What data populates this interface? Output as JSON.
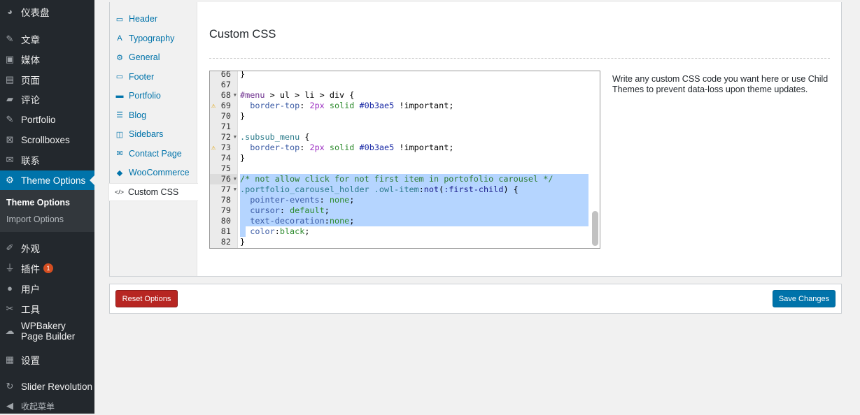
{
  "sidebar": {
    "items": [
      {
        "label": "仪表盘",
        "icon": "dashboard-icon"
      },
      {
        "label": "文章",
        "icon": "pin-icon"
      },
      {
        "label": "媒体",
        "icon": "media-icon"
      },
      {
        "label": "页面",
        "icon": "pages-icon"
      },
      {
        "label": "评论",
        "icon": "comments-icon"
      },
      {
        "label": "Portfolio",
        "icon": "pin-icon"
      },
      {
        "label": "Scrollboxes",
        "icon": "scrollbox-icon"
      },
      {
        "label": "联系",
        "icon": "mail-icon"
      },
      {
        "label": "Theme Options",
        "icon": "gear-icon"
      },
      {
        "label": "外观",
        "icon": "brush-icon"
      },
      {
        "label": "插件",
        "icon": "plugin-icon",
        "badge": "1"
      },
      {
        "label": "用户",
        "icon": "user-icon"
      },
      {
        "label": "工具",
        "icon": "wrench-icon"
      },
      {
        "label": "WPBakery Page Builder",
        "icon": "cloud-icon"
      },
      {
        "label": "设置",
        "icon": "settings-icon"
      },
      {
        "label": "Slider Revolution",
        "icon": "refresh-icon"
      },
      {
        "label": "收起菜单",
        "icon": "collapse-icon"
      }
    ],
    "submenu": [
      "Theme Options",
      "Import Options"
    ]
  },
  "tabs": [
    {
      "label": "Header",
      "icon": "monitor-icon"
    },
    {
      "label": "Typography",
      "icon": "typography-icon"
    },
    {
      "label": "General",
      "icon": "gear-icon"
    },
    {
      "label": "Footer",
      "icon": "monitor-icon"
    },
    {
      "label": "Portfolio",
      "icon": "briefcase-icon"
    },
    {
      "label": "Blog",
      "icon": "list-icon"
    },
    {
      "label": "Sidebars",
      "icon": "columns-icon"
    },
    {
      "label": "Contact Page",
      "icon": "envelope-icon"
    },
    {
      "label": "WooCommerce",
      "icon": "tag-icon"
    },
    {
      "label": "Custom CSS",
      "icon": "code-icon"
    }
  ],
  "section_title": "Custom CSS",
  "description": "Write any custom CSS code you want here or use Child Themes to prevent data-loss upon theme updates.",
  "editor": {
    "lines": [
      {
        "n": "66",
        "tokens": [
          {
            "t": "}"
          }
        ]
      },
      {
        "n": "67",
        "tokens": []
      },
      {
        "n": "68",
        "fold": true,
        "tokens": [
          {
            "t": "#menu",
            "c": "sel"
          },
          {
            "t": " > ul > li > div {"
          }
        ]
      },
      {
        "n": "69",
        "warn": true,
        "tokens": [
          {
            "t": "  "
          },
          {
            "t": "border-top",
            "c": "prop"
          },
          {
            "t": ": "
          },
          {
            "t": "2px",
            "c": "num"
          },
          {
            "t": " "
          },
          {
            "t": "solid",
            "c": "val"
          },
          {
            "t": " "
          },
          {
            "t": "#0b3ae5",
            "c": "hex"
          },
          {
            "t": " !important;"
          }
        ]
      },
      {
        "n": "70",
        "tokens": [
          {
            "t": "}"
          }
        ]
      },
      {
        "n": "71",
        "tokens": []
      },
      {
        "n": "72",
        "fold": true,
        "tokens": [
          {
            "t": ".subsub_menu",
            "c": "cls"
          },
          {
            "t": " {"
          }
        ]
      },
      {
        "n": "73",
        "warn": true,
        "tokens": [
          {
            "t": "  "
          },
          {
            "t": "border-top",
            "c": "prop"
          },
          {
            "t": ": "
          },
          {
            "t": "2px",
            "c": "num"
          },
          {
            "t": " "
          },
          {
            "t": "solid",
            "c": "val"
          },
          {
            "t": " "
          },
          {
            "t": "#0b3ae5",
            "c": "hex"
          },
          {
            "t": " !important;"
          }
        ]
      },
      {
        "n": "74",
        "tokens": [
          {
            "t": "}"
          }
        ]
      },
      {
        "n": "75",
        "tokens": []
      },
      {
        "n": "76",
        "fold": true,
        "sel": true,
        "cur": true,
        "tokens": [
          {
            "t": "/* not allow click for not first item in portofolio carousel */",
            "c": "com"
          }
        ]
      },
      {
        "n": "77",
        "fold": true,
        "sel": true,
        "tokens": [
          {
            "t": ".portfolio_carousel_holder .owl-item",
            "c": "cls"
          },
          {
            "t": ":"
          },
          {
            "t": "not",
            "c": "fn"
          },
          {
            "t": "("
          },
          {
            "t": ":first-child",
            "c": "fn"
          },
          {
            "t": ") {"
          }
        ]
      },
      {
        "n": "78",
        "sel": true,
        "tokens": [
          {
            "t": "  "
          },
          {
            "t": "pointer-events",
            "c": "prop"
          },
          {
            "t": ": "
          },
          {
            "t": "none",
            "c": "val"
          },
          {
            "t": ";"
          }
        ]
      },
      {
        "n": "79",
        "sel": true,
        "tokens": [
          {
            "t": "  "
          },
          {
            "t": "cursor",
            "c": "prop"
          },
          {
            "t": ": "
          },
          {
            "t": "default",
            "c": "val"
          },
          {
            "t": ";"
          }
        ]
      },
      {
        "n": "80",
        "sel": true,
        "tokens": [
          {
            "t": "  "
          },
          {
            "t": "text-decoration",
            "c": "prop"
          },
          {
            "t": ":"
          },
          {
            "t": "none",
            "c": "val"
          },
          {
            "t": ";"
          }
        ]
      },
      {
        "n": "81",
        "sel": true,
        "tokens": [
          {
            "t": "  "
          },
          {
            "t": "color",
            "c": "prop"
          },
          {
            "t": ":"
          },
          {
            "t": "black",
            "c": "val"
          },
          {
            "t": ";"
          }
        ]
      },
      {
        "n": "82",
        "tokens": [
          {
            "t": "}"
          }
        ]
      }
    ]
  },
  "buttons": {
    "reset": "Reset Options",
    "save": "Save Changes"
  },
  "colors": {
    "accent": "#0073aa",
    "reset": "#b72622",
    "sidebar": "#23282d"
  }
}
